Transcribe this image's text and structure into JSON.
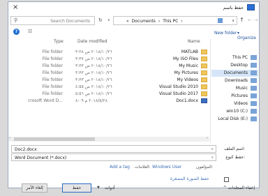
{
  "window": {
    "title": "حفظ باسم",
    "close": "×"
  },
  "address": {
    "search_placeholder": "Search Documents",
    "refresh": "↻",
    "breadcrumb": [
      "«",
      "Documents",
      "›",
      "This PC",
      "›"
    ],
    "dropdown": "∨",
    "up": "↑",
    "back": "←",
    "forward": "→"
  },
  "toolbar": {
    "help": "?",
    "view": "☷",
    "new_folder": "New folder",
    "organize": "▾ Organize"
  },
  "columns": {
    "type": "Type",
    "date": "Date modified",
    "name": "Name"
  },
  "files": [
    {
      "type": "File folder",
      "date": "٢٠١٨/١٠/٢٦ ص ٣:٢٨",
      "name": "MATLAB",
      "icon": "folder-icon"
    },
    {
      "type": "File folder",
      "date": "٢٠١٨/١٠/٢٦ ص ٣:٣٧",
      "name": "My ISO Files",
      "icon": "folder-icon"
    },
    {
      "type": "File folder",
      "date": "٢٠١٨/١٠/٢٦ ص ٣:٣٣",
      "name": "My Music",
      "icon": "folder-icon"
    },
    {
      "type": "File folder",
      "date": "٢٠١٨/١٠/٢٦ ص ٣:٣٣",
      "name": "My Pictures",
      "icon": "folder-icon"
    },
    {
      "type": "File folder",
      "date": "٢٠١٨/١٠/٢٦ ص ٣:٣٣",
      "name": "My Videos",
      "icon": "folder-icon"
    },
    {
      "type": "File folder",
      "date": "٢٠١٨/١٠/٢٦ ص ٤:٥٥",
      "name": "Visual Studio 2010",
      "icon": "folder-icon"
    },
    {
      "type": "File folder",
      "date": "٢٠١٨/١٠/٢٦ ص ٥:٥٦",
      "name": "Visual Studio 2017",
      "icon": "folder-icon"
    },
    {
      "type": "crosoft Word D...",
      "date": "٢٠١٨/٥/٢٨ م ٨:٠٩",
      "name": "Doc1.docx",
      "icon": "word-doc-icon"
    }
  ],
  "nav": [
    {
      "label": "This PC",
      "icon": "computer-icon"
    },
    {
      "label": "Desktop",
      "icon": "desktop-icon"
    },
    {
      "label": "Documents",
      "icon": "documents-icon",
      "selected": true
    },
    {
      "label": "Downloads",
      "icon": "downloads-icon"
    },
    {
      "label": "Music",
      "icon": "music-icon"
    },
    {
      "label": "Pictures",
      "icon": "pictures-icon"
    },
    {
      "label": "Videos",
      "icon": "videos-icon"
    },
    {
      "label": "win10 (C:)",
      "icon": "drive-icon"
    },
    {
      "label": "Local Disk (E:)",
      "icon": "drive-icon"
    }
  ],
  "form": {
    "filename_label": "اسم الملف:",
    "filename_value": "Doc2.docx",
    "savetype_label": "حفظ كنوع:",
    "savetype_value": "Word Document (*.docx)",
    "authors_label": "المؤلفون:",
    "authors_value": "Windows User",
    "tags_label": "العلامات:",
    "tags_value": "Add a tag",
    "thumbnail_label": "حفظ الصورة المصغرة"
  },
  "footer": {
    "hide_folders": "^ إخفاء المجلدات",
    "tools": "أدوات",
    "save": "حفظ",
    "cancel": "إلغاء الأمر"
  }
}
